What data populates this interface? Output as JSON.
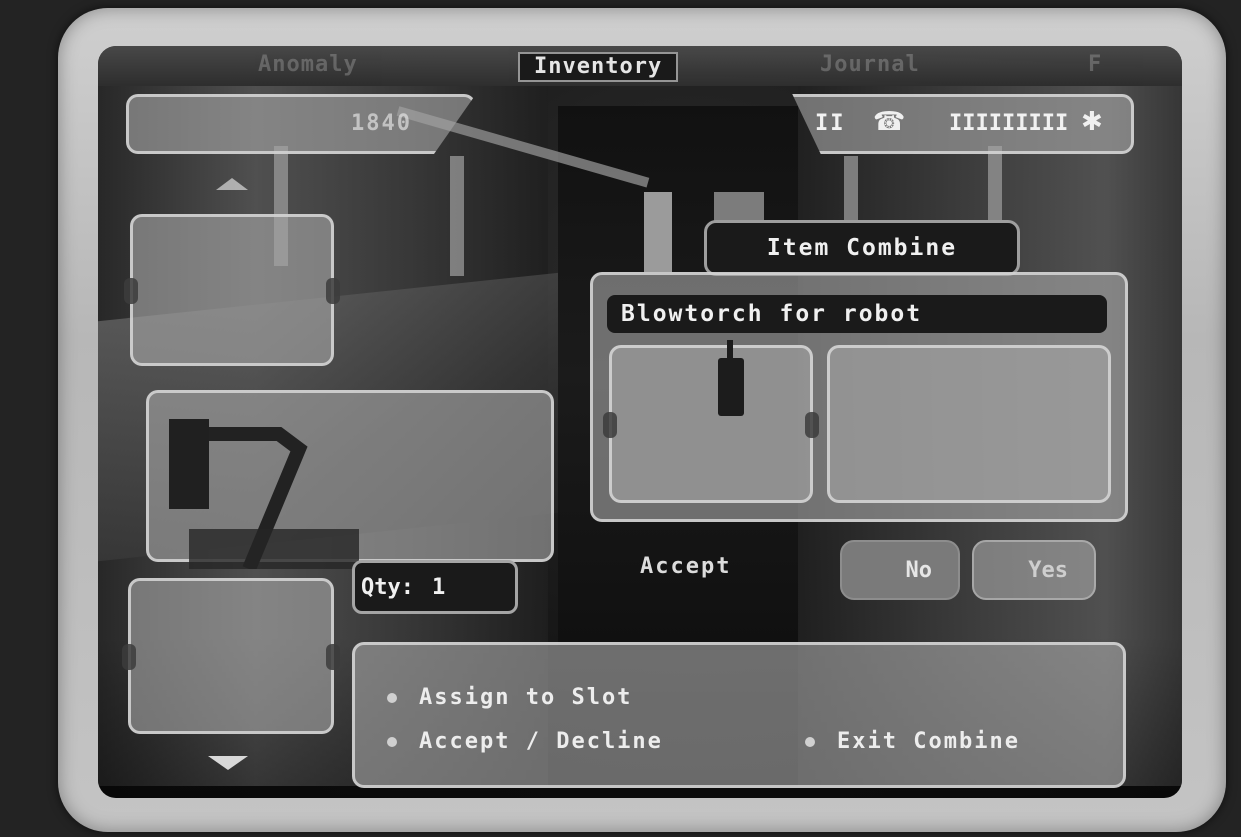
{
  "tabs": [
    {
      "label": "Anomaly",
      "active": false
    },
    {
      "label": "Inventory",
      "active": true
    },
    {
      "label": "Journal",
      "active": false
    },
    {
      "label": "F",
      "active": false
    }
  ],
  "top_left": {
    "count": "1840"
  },
  "status": {
    "pause": "II",
    "bars": "IIIIIIIII"
  },
  "combine": {
    "title": "Item Combine",
    "item_name": "Blowtorch for robot"
  },
  "quantity": {
    "label": "Qty:",
    "value": "1"
  },
  "accept": {
    "label": "Accept",
    "no_label": "No",
    "yes_label": "Yes",
    "selected": "No"
  },
  "help": {
    "assign": "Assign to Slot",
    "accept_decline": "Accept / Decline",
    "exit": "Exit Combine"
  },
  "icons": [
    "up-arrow-icon",
    "down-arrow-icon",
    "pause-icon",
    "phone-icon",
    "health-bar-icon",
    "gear-icon",
    "blowtorch-icon"
  ]
}
